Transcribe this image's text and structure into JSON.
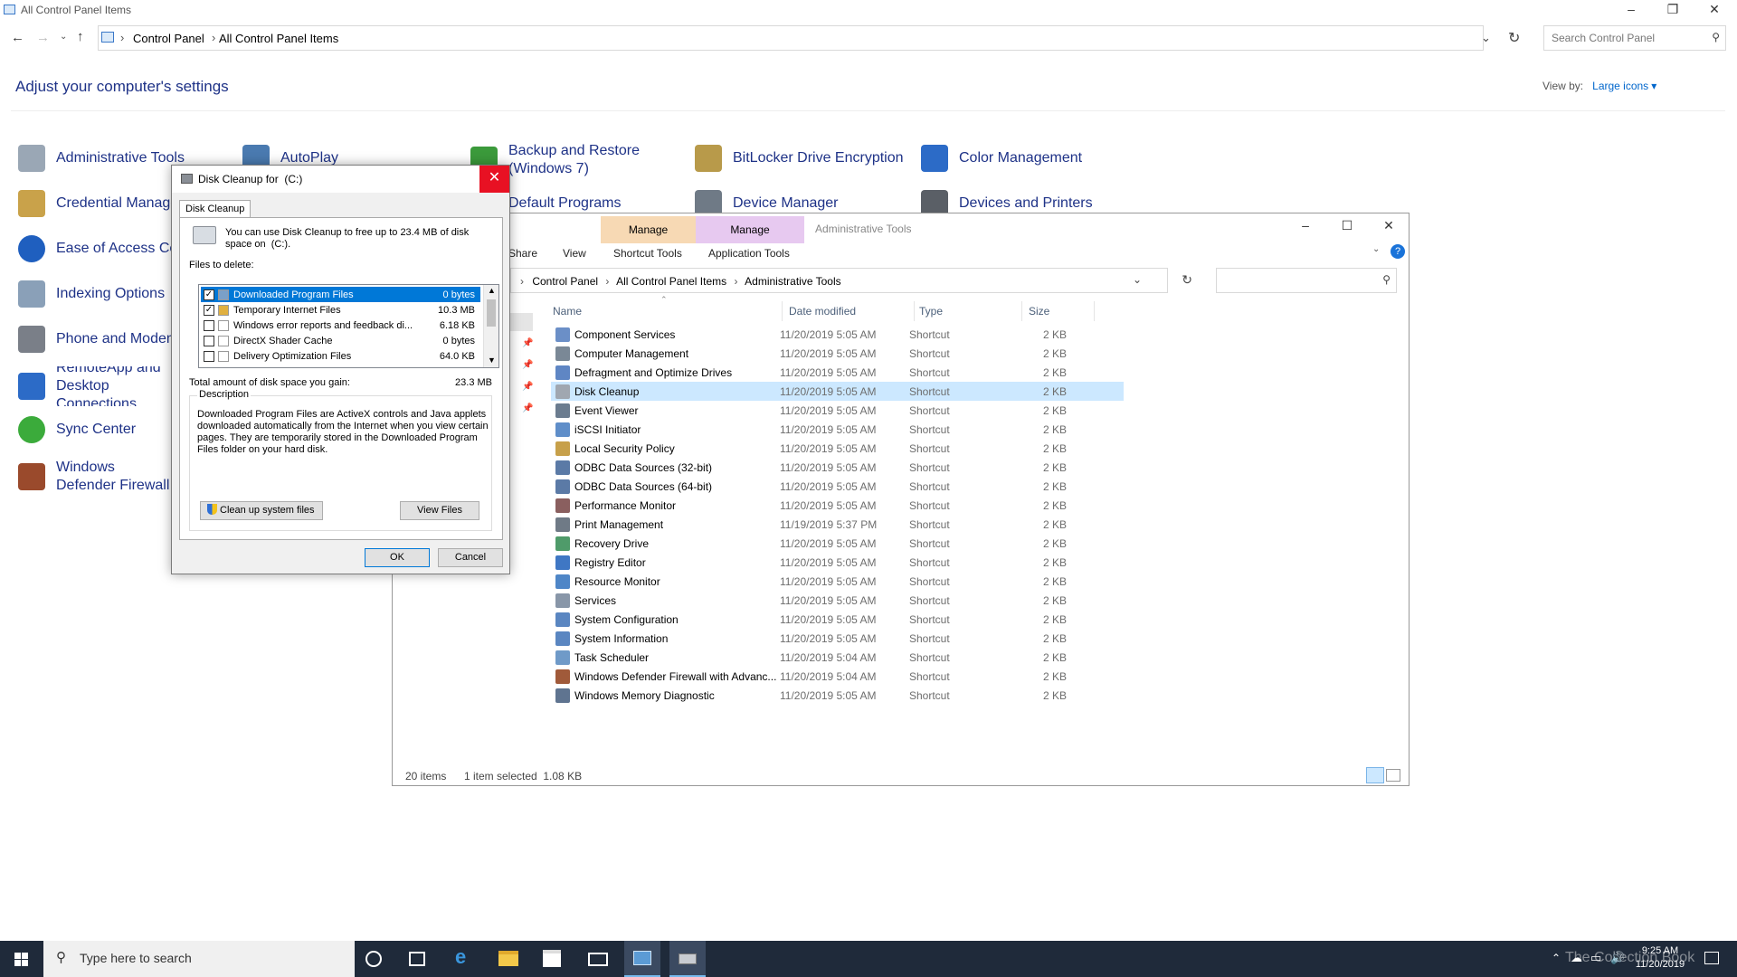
{
  "control_panel": {
    "window_title": "All Control Panel Items",
    "breadcrumb": [
      "Control Panel",
      "All Control Panel Items"
    ],
    "search_placeholder": "Search Control Panel",
    "heading": "Adjust your computer's settings",
    "view_by_label": "View by:",
    "view_by_value": "Large icons",
    "items": [
      {
        "label": "Administrative Tools",
        "icon": "admin-tools-icon"
      },
      {
        "label": "AutoPlay",
        "icon": "autoplay-icon"
      },
      {
        "label": "Backup and Restore (Windows 7)",
        "icon": "backup-icon"
      },
      {
        "label": "BitLocker Drive Encryption",
        "icon": "bitlocker-icon"
      },
      {
        "label": "Color Management",
        "icon": "color-management-icon"
      },
      {
        "label": "Credential Manager",
        "icon": "credential-manager-icon"
      },
      {
        "label": "Default Programs",
        "icon": "default-programs-icon"
      },
      {
        "label": "Device Manager",
        "icon": "device-manager-icon"
      },
      {
        "label": "Devices and Printers",
        "icon": "devices-printers-icon"
      },
      {
        "label": "Ease of Access Center",
        "icon": "ease-of-access-icon"
      },
      {
        "label": "Indexing Options",
        "icon": "indexing-icon"
      },
      {
        "label": "Phone and Modem",
        "icon": "phone-modem-icon"
      },
      {
        "label": "RemoteApp and Desktop Connections",
        "icon": "remoteapp-icon"
      },
      {
        "label": "Sync Center",
        "icon": "sync-center-icon"
      },
      {
        "label": "Windows Defender Firewall",
        "icon": "firewall-icon"
      }
    ]
  },
  "explorer": {
    "ribbon_tabs": [
      "Share",
      "View"
    ],
    "manage_1": "Manage",
    "shortcut_tools": "Shortcut Tools",
    "manage_2": "Manage",
    "application_tools": "Application Tools",
    "window_title": "Administrative Tools",
    "breadcrumb": [
      "Control Panel",
      "All Control Panel Items",
      "Administrative Tools"
    ],
    "columns": {
      "name": "Name",
      "date": "Date modified",
      "type": "Type",
      "size": "Size"
    },
    "rows": [
      {
        "name": "Component Services",
        "date": "11/20/2019 5:05 AM",
        "type": "Shortcut",
        "size": "2 KB"
      },
      {
        "name": "Computer Management",
        "date": "11/20/2019 5:05 AM",
        "type": "Shortcut",
        "size": "2 KB"
      },
      {
        "name": "Defragment and Optimize Drives",
        "date": "11/20/2019 5:05 AM",
        "type": "Shortcut",
        "size": "2 KB"
      },
      {
        "name": "Disk Cleanup",
        "date": "11/20/2019 5:05 AM",
        "type": "Shortcut",
        "size": "2 KB"
      },
      {
        "name": "Event Viewer",
        "date": "11/20/2019 5:05 AM",
        "type": "Shortcut",
        "size": "2 KB"
      },
      {
        "name": "iSCSI Initiator",
        "date": "11/20/2019 5:05 AM",
        "type": "Shortcut",
        "size": "2 KB"
      },
      {
        "name": "Local Security Policy",
        "date": "11/20/2019 5:05 AM",
        "type": "Shortcut",
        "size": "2 KB"
      },
      {
        "name": "ODBC Data Sources (32-bit)",
        "date": "11/20/2019 5:05 AM",
        "type": "Shortcut",
        "size": "2 KB"
      },
      {
        "name": "ODBC Data Sources (64-bit)",
        "date": "11/20/2019 5:05 AM",
        "type": "Shortcut",
        "size": "2 KB"
      },
      {
        "name": "Performance Monitor",
        "date": "11/20/2019 5:05 AM",
        "type": "Shortcut",
        "size": "2 KB"
      },
      {
        "name": "Print Management",
        "date": "11/19/2019 5:37 PM",
        "type": "Shortcut",
        "size": "2 KB"
      },
      {
        "name": "Recovery Drive",
        "date": "11/20/2019 5:05 AM",
        "type": "Shortcut",
        "size": "2 KB"
      },
      {
        "name": "Registry Editor",
        "date": "11/20/2019 5:05 AM",
        "type": "Shortcut",
        "size": "2 KB"
      },
      {
        "name": "Resource Monitor",
        "date": "11/20/2019 5:05 AM",
        "type": "Shortcut",
        "size": "2 KB"
      },
      {
        "name": "Services",
        "date": "11/20/2019 5:05 AM",
        "type": "Shortcut",
        "size": "2 KB"
      },
      {
        "name": "System Configuration",
        "date": "11/20/2019 5:05 AM",
        "type": "Shortcut",
        "size": "2 KB"
      },
      {
        "name": "System Information",
        "date": "11/20/2019 5:05 AM",
        "type": "Shortcut",
        "size": "2 KB"
      },
      {
        "name": "Task Scheduler",
        "date": "11/20/2019 5:04 AM",
        "type": "Shortcut",
        "size": "2 KB"
      },
      {
        "name": "Windows Defender Firewall with Advanc...",
        "date": "11/20/2019 5:04 AM",
        "type": "Shortcut",
        "size": "2 KB"
      },
      {
        "name": "Windows Memory Diagnostic",
        "date": "11/20/2019 5:05 AM",
        "type": "Shortcut",
        "size": "2 KB"
      }
    ],
    "selected_row": "Disk Cleanup",
    "status_count": "20 items",
    "status_selected": "1 item selected  1.08 KB"
  },
  "dialog": {
    "title": "Disk Cleanup for  (C:)",
    "tab": "Disk Cleanup",
    "intro": "You can use Disk Cleanup to free up to 23.4 MB of disk space on  (C:).",
    "files_label": "Files to delete:",
    "files": [
      {
        "name": "Downloaded Program Files",
        "size": "0 bytes",
        "checked": true
      },
      {
        "name": "Temporary Internet Files",
        "size": "10.3 MB",
        "checked": true
      },
      {
        "name": "Windows error reports and feedback di...",
        "size": "6.18 KB",
        "checked": false
      },
      {
        "name": "DirectX Shader Cache",
        "size": "0 bytes",
        "checked": false
      },
      {
        "name": "Delivery Optimization Files",
        "size": "64.0 KB",
        "checked": false
      }
    ],
    "total_label": "Total amount of disk space you gain:",
    "total_value": "23.3 MB",
    "description_label": "Description",
    "description": "Downloaded Program Files are ActiveX controls and Java applets downloaded automatically from the Internet when you view certain pages. They are temporarily stored in the Downloaded Program Files folder on your hard disk.",
    "cleanup_system_button": "Clean up system files",
    "view_files_button": "View Files",
    "ok_button": "OK",
    "cancel_button": "Cancel"
  },
  "taskbar": {
    "search_placeholder": "Type here to search",
    "time": "9:25 AM",
    "date": "11/20/2019",
    "watermark": "The Collection Book"
  },
  "colors": {
    "accent": "#0078d7",
    "link": "#1e3287",
    "close_red": "#e81123",
    "taskbar": "#1f2a3a"
  }
}
